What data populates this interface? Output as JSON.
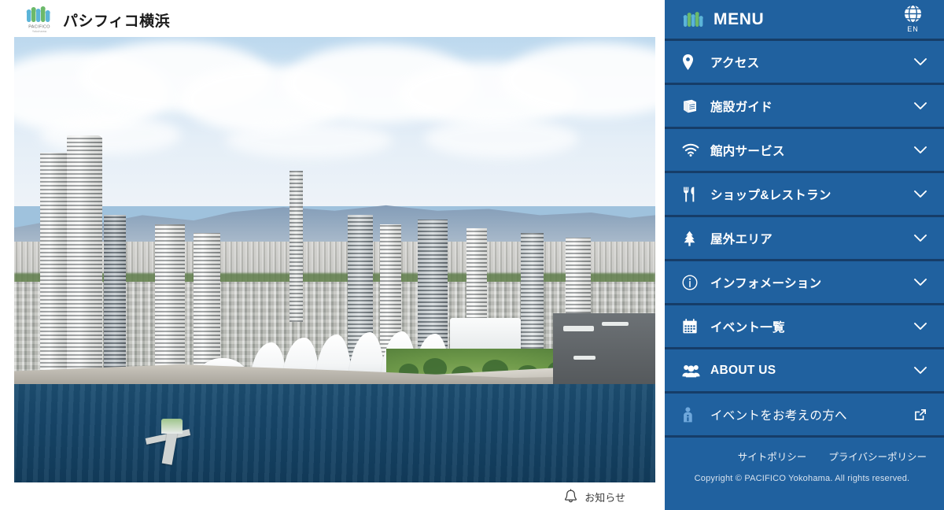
{
  "brand": {
    "name": "パシフィコ横浜",
    "logo_mark": "pacifico-logo-mark",
    "logo_caption": "PACIFICO",
    "logo_subcaption": "Yokohama"
  },
  "hero": {
    "name": "yokohama-minatomirai-aerial-photo",
    "alt": "パシフィコ横浜とみなとみらい地区の空撮"
  },
  "notice": {
    "icon": "bell-icon",
    "label": "お知らせ"
  },
  "sidebar": {
    "menu_label": "MENU",
    "menu_icon": "pacifico-logo-mark",
    "language": {
      "icon": "globe-icon",
      "label": "EN"
    },
    "items": [
      {
        "label": "アクセス",
        "icon": "map-pin-icon",
        "chevron": "chevron-down-icon",
        "type": "accordion"
      },
      {
        "label": "施設ガイド",
        "icon": "book-icon",
        "chevron": "chevron-down-icon",
        "type": "accordion"
      },
      {
        "label": "館内サービス",
        "icon": "wifi-icon",
        "chevron": "chevron-down-icon",
        "type": "accordion"
      },
      {
        "label": "ショップ&レストラン",
        "icon": "cutlery-icon",
        "chevron": "chevron-down-icon",
        "type": "accordion"
      },
      {
        "label": "屋外エリア",
        "icon": "tree-icon",
        "chevron": "chevron-down-icon",
        "type": "accordion"
      },
      {
        "label": "インフォメーション",
        "icon": "info-circle-icon",
        "chevron": "chevron-down-icon",
        "type": "accordion"
      },
      {
        "label": "イベント一覧",
        "icon": "calendar-icon",
        "chevron": "chevron-down-icon",
        "type": "accordion"
      },
      {
        "label": "ABOUT US",
        "icon": "people-icon",
        "chevron": "chevron-down-icon",
        "type": "accordion"
      }
    ],
    "external_item": {
      "label": "イベントをお考えの方へ",
      "icon": "person-info-icon",
      "external_icon": "external-link-icon",
      "icon_color": "#6fa8dc"
    },
    "footer": {
      "links": [
        {
          "label": "サイトポリシー"
        },
        {
          "label": "プライバシーポリシー"
        }
      ],
      "copyright": "Copyright © PACIFICO Yokohama. All rights reserved."
    }
  },
  "colors": {
    "sidebar_blue": "#20619f",
    "divider_navy": "#163d68",
    "accent_light_blue": "#6fa8dc",
    "logo_green": "#6cb96a",
    "logo_blue": "#5bb4d8",
    "text_white": "#ffffff"
  }
}
